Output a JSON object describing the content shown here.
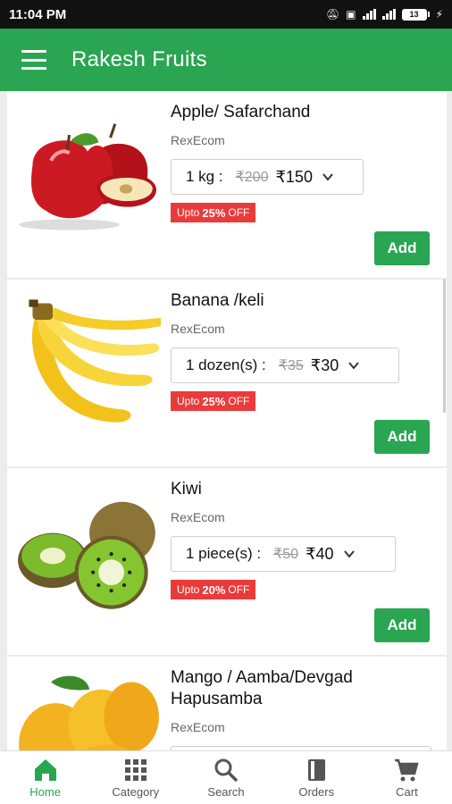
{
  "status_bar": {
    "time": "11:04 PM",
    "battery": "13"
  },
  "app_bar": {
    "title": "Rakesh Fruits"
  },
  "products": [
    {
      "name_line1": "Apple/ Safarchand",
      "name_line2": "",
      "vendor": "RexEcom",
      "unit": "1 kg :",
      "mrp": "₹200",
      "price": "₹150",
      "discount_prefix": "Upto",
      "discount_value": "25%",
      "discount_suffix": "OFF",
      "add_label": "Add"
    },
    {
      "name_line1": "Banana /keli",
      "name_line2": "",
      "vendor": "RexEcom",
      "unit": "1 dozen(s) :",
      "mrp": "₹35",
      "price": "₹30",
      "discount_prefix": "Upto",
      "discount_value": "25%",
      "discount_suffix": "OFF",
      "add_label": "Add"
    },
    {
      "name_line1": "Kiwi",
      "name_line2": "",
      "vendor": "RexEcom",
      "unit": "1 piece(s) :",
      "mrp": "₹50",
      "price": "₹40",
      "discount_prefix": "Upto",
      "discount_value": "20%",
      "discount_suffix": "OFF",
      "add_label": "Add"
    },
    {
      "name_line1": "Mango / Aamba/Devgad",
      "name_line2": "Hapusamba",
      "vendor": "RexEcom"
    }
  ],
  "bottom_nav": [
    {
      "label": "Home",
      "icon": "home-icon",
      "active": true
    },
    {
      "label": "Category",
      "icon": "grid-icon"
    },
    {
      "label": "Search",
      "icon": "search-icon"
    },
    {
      "label": "Orders",
      "icon": "book-icon"
    },
    {
      "label": "Cart",
      "icon": "cart-icon"
    }
  ],
  "colors": {
    "primary": "#2aa552",
    "discount": "#ea3b3b",
    "status_bar": "#111111"
  }
}
